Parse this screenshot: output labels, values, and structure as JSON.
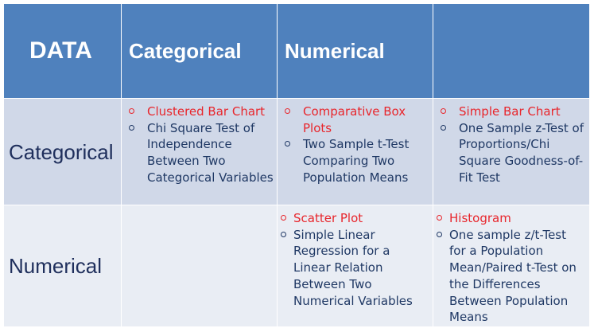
{
  "header": {
    "corner": "DATA",
    "col1": "Categorical",
    "col2": "Numerical",
    "col3": ""
  },
  "rows": [
    {
      "label": "Categorical",
      "cells": [
        {
          "items": [
            "Clustered Bar Chart",
            "Chi Square Test of Independence Between Two Categorical Variables"
          ]
        },
        {
          "items": [
            "Comparative Box Plots",
            "Two Sample t-Test Comparing Two Population Means"
          ]
        },
        {
          "items": [
            "Simple Bar Chart",
            "One Sample z-Test of Proportions/Chi Square Goodness-of-Fit Test"
          ]
        }
      ]
    },
    {
      "label": "Numerical",
      "cells": [
        {
          "items": []
        },
        {
          "items": [
            "Scatter Plot",
            "Simple Linear Regression for a Linear Relation Between Two Numerical Variables"
          ]
        },
        {
          "items": [
            "Histogram",
            "One sample z/t-Test for a Population Mean/Paired t-Test on the Differences Between Population Means"
          ]
        }
      ]
    }
  ],
  "colors": {
    "header_bg": "#4f81bd",
    "row1_bg": "#d0d8e8",
    "row2_bg": "#e9edf4",
    "plot_name": "#e8262c",
    "text": "#1f3864"
  }
}
